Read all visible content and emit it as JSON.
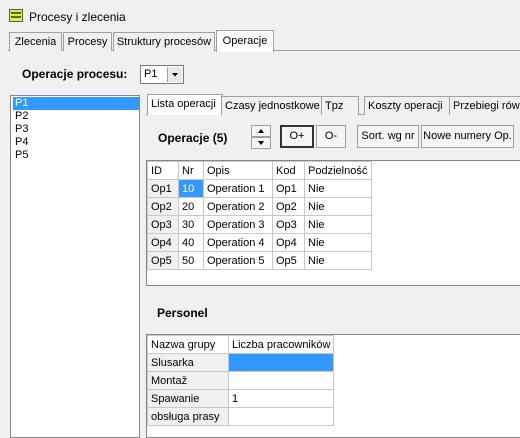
{
  "window": {
    "title": "Procesy i zlecenia"
  },
  "main_tabs": [
    "Zlecenia",
    "Procesy",
    "Struktury procesów",
    "Operacje"
  ],
  "process_label": "Operacje procesu:",
  "process_combo": {
    "value": "P1"
  },
  "process_list": [
    "P1",
    "P2",
    "P3",
    "P4",
    "P5"
  ],
  "inner_tabs": [
    "Lista operacji",
    "Czasy jednostkowe",
    "Tpz",
    "Koszty operacji",
    "Przebiegi równ"
  ],
  "operations": {
    "heading": "Operacje (5)",
    "btn_add": "O+",
    "btn_remove": "O-",
    "btn_sort": "Sort. wg nr",
    "btn_renumber": "Nowe numery Op.",
    "columns": [
      "ID",
      "Nr",
      "Opis",
      "Kod",
      "Podzielność"
    ],
    "rows": [
      [
        "Op1",
        "10",
        "Operation 1",
        "Op1",
        "Nie"
      ],
      [
        "Op2",
        "20",
        "Operation 2",
        "Op2",
        "Nie"
      ],
      [
        "Op3",
        "30",
        "Operation 3",
        "Op3",
        "Nie"
      ],
      [
        "Op4",
        "40",
        "Operation 4",
        "Op4",
        "Nie"
      ],
      [
        "Op5",
        "50",
        "Operation 5",
        "Op5",
        "Nie"
      ]
    ]
  },
  "personnel": {
    "heading": "Personel",
    "columns": [
      "Nazwa grupy",
      "Liczba pracowników"
    ],
    "rows": [
      [
        "Slusarka",
        ""
      ],
      [
        "Montaž",
        ""
      ],
      [
        "Spawanie",
        "1"
      ],
      [
        "obsługa prasy",
        ""
      ]
    ]
  }
}
